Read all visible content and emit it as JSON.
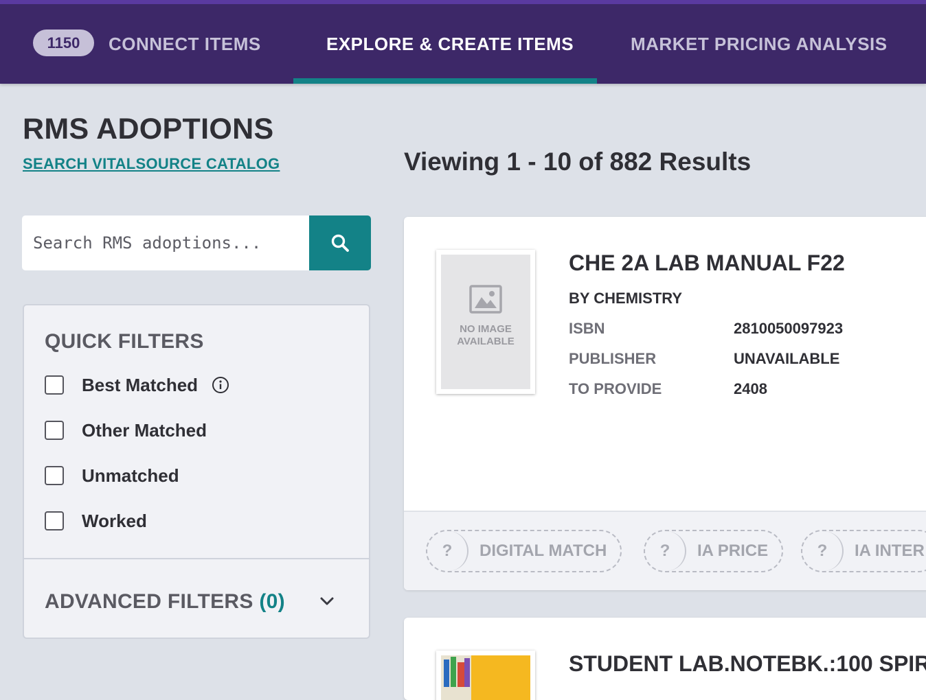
{
  "nav": {
    "badge_count": "1150",
    "tabs": [
      {
        "label": "CONNECT ITEMS",
        "active": false
      },
      {
        "label": "EXPLORE & CREATE ITEMS",
        "active": true
      },
      {
        "label": "MARKET PRICING ANALYSIS",
        "active": false
      }
    ]
  },
  "header": {
    "title": "RMS ADOPTIONS",
    "catalog_link": "SEARCH VITALSOURCE CATALOG",
    "results": "Viewing 1 - 10 of 882 Results"
  },
  "search": {
    "placeholder": "Search RMS adoptions..."
  },
  "filters": {
    "title": "QUICK FILTERS",
    "options": [
      {
        "label": "Best Matched",
        "checked": false,
        "has_info": true
      },
      {
        "label": "Other Matched",
        "checked": false
      },
      {
        "label": "Unmatched",
        "checked": false
      },
      {
        "label": "Worked",
        "checked": false
      }
    ],
    "advanced_label": "ADVANCED FILTERS",
    "advanced_count": "(0)"
  },
  "results": [
    {
      "title": "CHE 2A LAB MANUAL F22",
      "author": "BY CHEMISTRY",
      "no_image_text": "NO IMAGE AVAILABLE",
      "fields": [
        {
          "label": "ISBN",
          "value": "2810050097923"
        },
        {
          "label": "PUBLISHER",
          "value": "UNAVAILABLE"
        },
        {
          "label": "TO PROVIDE",
          "value": "2408"
        }
      ],
      "statuses": [
        {
          "symbol": "?",
          "label": "DIGITAL MATCH"
        },
        {
          "symbol": "?",
          "label": "IA PRICE"
        },
        {
          "symbol": "?",
          "label": "IA INTER"
        }
      ]
    },
    {
      "title": "STUDENT LAB.NOTEBK.:100 SPIR"
    }
  ],
  "colors": {
    "nav_bg": "#3d2868",
    "accent": "#138287",
    "page_bg": "#dde1e8"
  }
}
